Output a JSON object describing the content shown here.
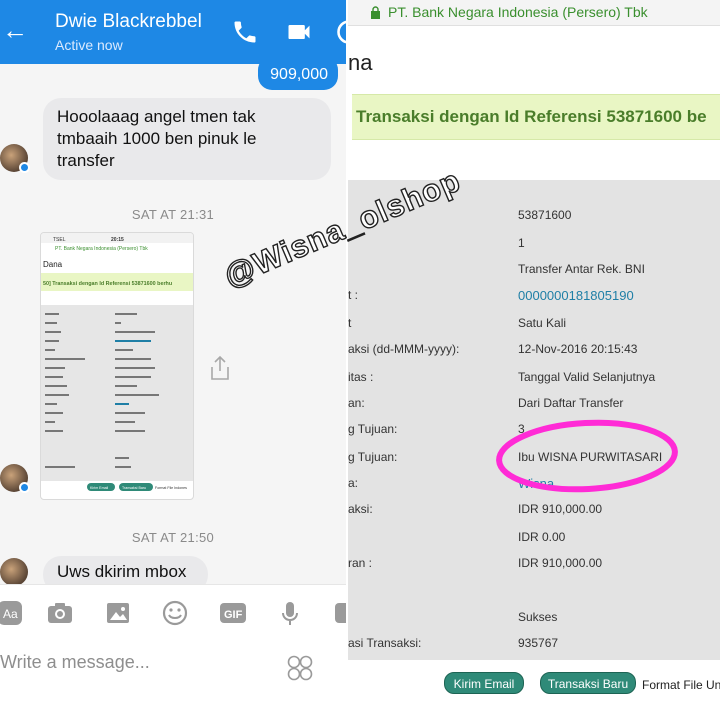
{
  "messenger": {
    "contact_name": "Dwie Blackrebbel",
    "status": "Active now",
    "messages": [
      {
        "direction": "outgoing",
        "text": "909,000"
      },
      {
        "direction": "incoming",
        "text": "Hooolaaag angel tmen tak tmbaaih 1000 ben pinuk le transfer"
      },
      {
        "direction": "incoming",
        "text": "Uws dkirim mbox"
      }
    ],
    "timestamps": [
      "SAT AT 21:31",
      "SAT AT 21:50"
    ],
    "compose_placeholder": "Write a message...",
    "toolbar_icons": [
      "text-format-icon",
      "camera-icon",
      "image-icon",
      "emoji-icon",
      "gif-icon",
      "mic-icon",
      "more-icon"
    ],
    "thumbnail": {
      "status_bar_left": "TSEL",
      "status_bar_time": "20:15",
      "url": "PT. Bank Negara Indonesia (Persero) Tbk",
      "heading": "Dana",
      "band": "50] Transaksi dengan Id Referensi 53871600 berhu",
      "button_1": "Kirim Email",
      "button_2": "Transaksi Baru",
      "footer_text": "Format File Indones"
    }
  },
  "bank": {
    "url": "PT. Bank Negara Indonesia (Persero) Tbk",
    "page_fragment": "na",
    "title": "Transaksi dengan Id Referensi 53871600 be",
    "rows": [
      {
        "label": "",
        "value": "53871600"
      },
      {
        "label": "",
        "value": "1"
      },
      {
        "label": "",
        "value": "Transfer Antar Rek. BNI"
      },
      {
        "label": "t :",
        "value": "0000000181805190"
      },
      {
        "label": "t",
        "value": "Satu Kali"
      },
      {
        "label": "aksi (dd-MMM-yyyy):",
        "value": "12-Nov-2016 20:15:43"
      },
      {
        "label": "itas :",
        "value": "Tanggal Valid Selanjutnya"
      },
      {
        "label": "an:",
        "value": "Dari Daftar Transfer"
      },
      {
        "label": "g Tujuan:",
        "value": "3"
      },
      {
        "label": "g Tujuan:",
        "value": "Ibu WISNA PURWITASARI"
      },
      {
        "label": "a:",
        "value": "Wisna"
      },
      {
        "label": "aksi:",
        "value": "IDR 910,000.00"
      },
      {
        "label": "",
        "value": "IDR 0.00"
      },
      {
        "label": "ran :",
        "value": "IDR 910,000.00"
      },
      {
        "label": "",
        "value": "Sukses"
      },
      {
        "label": "asi Transaksi:",
        "value": "935767"
      }
    ],
    "buttons": {
      "kirim_email": "Kirim Email",
      "transaksi_baru": "Transaksi Baru"
    },
    "footer_text": "Format File Und"
  },
  "watermark": "@Wisna_olshop",
  "colors": {
    "messenger_blue": "#1e88e5",
    "bank_green": "#3a8f2e",
    "highlight": "#ff2bd6",
    "button_teal": "#2f8a78"
  }
}
